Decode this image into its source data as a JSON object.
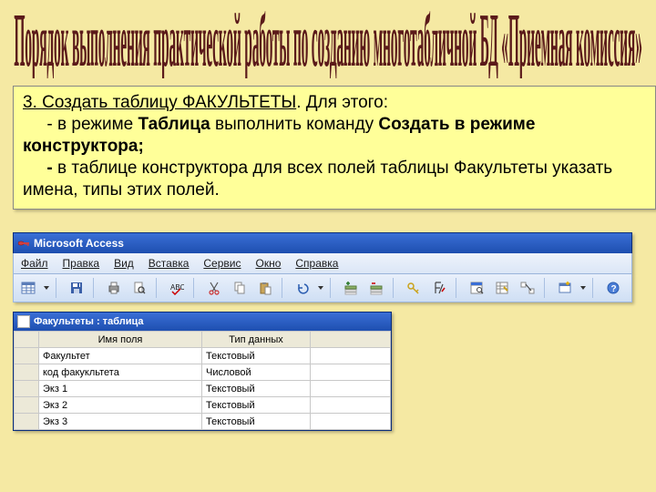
{
  "title": "Порядок выполнения практической работы по созданию многотабличной БД «Приемная комиссия»",
  "instruction": {
    "line1_u": "3. Создать таблицу ФАКУЛЬТЕТЫ",
    "line1_rest": ". Для этого:",
    "line2_pre": "     - в режиме ",
    "line2_b1": "Таблица",
    "line2_mid": " выполнить команду ",
    "line2_b2": "Создать в режиме конструктора;",
    "line3_pre": "     ",
    "line3_b": "- ",
    "line3_rest": "в таблице конструктора для всех полей таблицы Факультеты указать имена, типы этих полей."
  },
  "app": {
    "title": "Microsoft Access",
    "menus": [
      "Файл",
      "Правка",
      "Вид",
      "Вставка",
      "Сервис",
      "Окно",
      "Справка"
    ]
  },
  "subwindow": {
    "title": "Факультеты : таблица",
    "columns": [
      "Имя поля",
      "Тип данных"
    ],
    "rows": [
      {
        "name": "Факультет",
        "type": "Текстовый"
      },
      {
        "name": "код факукльтета",
        "type": "Числовой"
      },
      {
        "name": "Экз 1",
        "type": "Текстовый"
      },
      {
        "name": "Экз 2",
        "type": "Текстовый"
      },
      {
        "name": "Экз 3",
        "type": "Текстовый"
      }
    ]
  }
}
